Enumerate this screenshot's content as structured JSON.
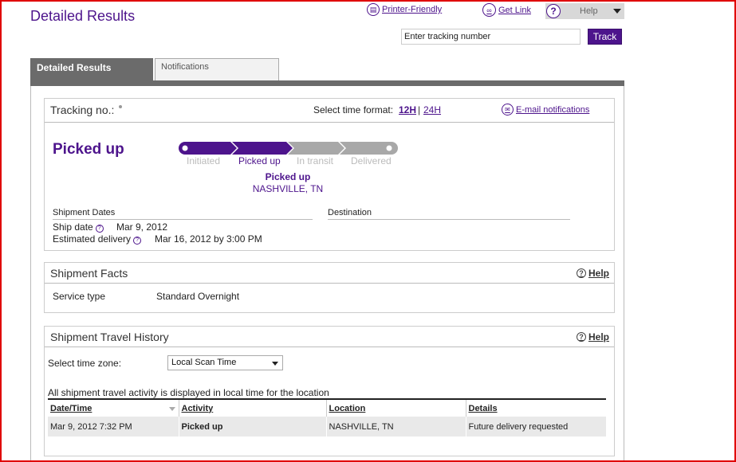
{
  "page_title": "Detailed Results",
  "top_links": {
    "printer_friendly": "Printer-Friendly",
    "get_link": "Get Link",
    "help_label": "Help"
  },
  "tracking_search": {
    "input_value": "Enter tracking number",
    "button_label": "Track"
  },
  "tabs": [
    {
      "label": "Detailed Results",
      "active": true
    },
    {
      "label": "Notifications",
      "active": false
    }
  ],
  "summary": {
    "tracking_label": "Tracking no.:",
    "time_format_label": "Select time format:",
    "time_format_12h": "12H",
    "time_format_separator": "|",
    "time_format_24h": "24H",
    "email_notifications": "E-mail notifications",
    "current_status": "Picked up",
    "progress_steps": [
      {
        "label": "Initiated",
        "complete": true
      },
      {
        "label": "Picked up",
        "complete": true
      },
      {
        "label": "In transit",
        "complete": false
      },
      {
        "label": "Delivered",
        "complete": false
      }
    ],
    "status_detail": "Picked up",
    "status_location": "NASHVILLE, TN",
    "shipment_dates_heading": "Shipment Dates",
    "destination_heading": "Destination",
    "ship_date_label": "Ship date",
    "ship_date_value": "Mar 9, 2012",
    "estimated_delivery_label": "Estimated delivery",
    "estimated_delivery_value": "Mar 16, 2012 by 3:00 PM"
  },
  "shipment_facts": {
    "title": "Shipment Facts",
    "help": "Help",
    "service_type_label": "Service type",
    "service_type_value": "Standard Overnight"
  },
  "travel_history": {
    "title": "Shipment Travel History",
    "help": "Help",
    "time_zone_label": "Select time zone:",
    "time_zone_value": "Local Scan Time",
    "note": "All shipment travel activity is displayed in local time for the location",
    "columns": [
      "Date/Time",
      "Activity",
      "Location",
      "Details"
    ],
    "rows": [
      [
        "Mar 9, 2012 7:32 PM",
        "Picked up",
        "NASHVILLE, TN",
        "Future delivery requested"
      ]
    ]
  },
  "colors": {
    "brand_purple": "#4d148c",
    "tab_gray": "#6b6b6b",
    "pending_gray": "#a8a8a8"
  }
}
